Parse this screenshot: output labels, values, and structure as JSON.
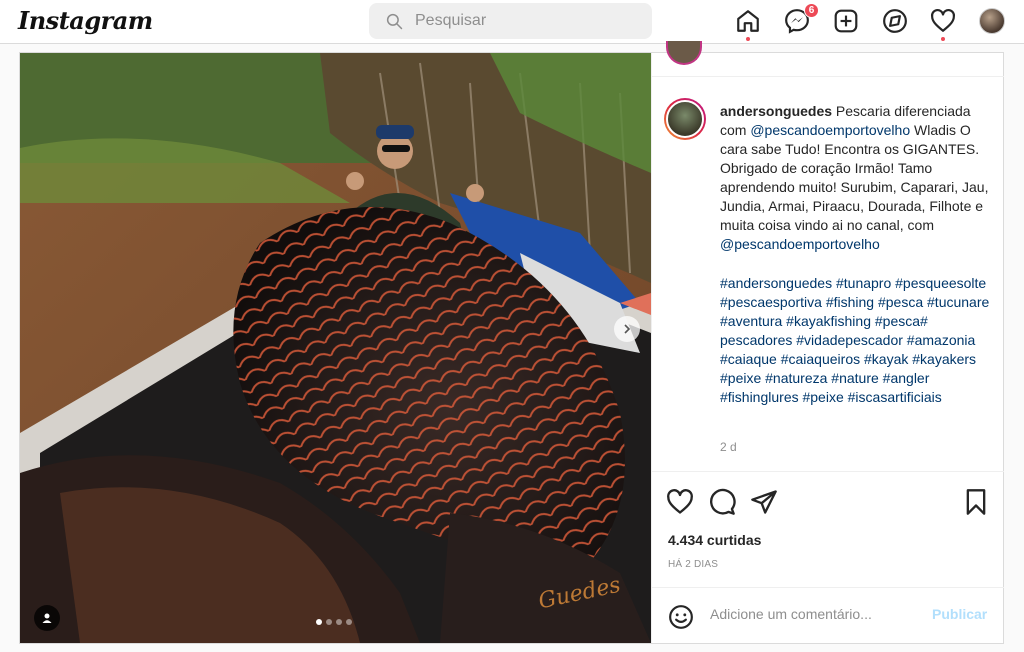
{
  "app": {
    "logo": "Instagram"
  },
  "search": {
    "placeholder": "Pesquisar"
  },
  "nav": {
    "items": [
      {
        "name": "home-icon",
        "active": true
      },
      {
        "name": "messenger-icon",
        "badge": "6"
      },
      {
        "name": "new-post-icon"
      },
      {
        "name": "explore-icon"
      },
      {
        "name": "activity-heart-icon",
        "dot": true
      },
      {
        "name": "profile-avatar"
      }
    ]
  },
  "post": {
    "caption": {
      "username": "andersonguedes",
      "text_1": " Pescaria diferenciada com ",
      "mention_1": "@pescandoemportovelho",
      "text_2": " Wladis O cara sabe Tudo! Encontra os GIGANTES. Obrigado de coração Irmão! Tamo aprendendo muito! Surubim, Caparari, Jau, Jundia, Armai, Piraacu, Dourada, Filhote e muita coisa vindo ai no canal, com ",
      "mention_2": "@pescandoemportovelho",
      "hashtags": "#andersonguedes #tunapro #pesqueesolte #pescaesportiva #fishing #pesca #tucunare #aventura #kayakfishing #pesca# pescadores #vidadepescador  #amazonia #caiaque #caiaqueiros #kayak #kayakers #peixe #natureza #nature #angler #fishinglures #peixe #iscasartificiais",
      "age": "2 d"
    },
    "likes": "4.434 curtidas",
    "date": "HÁ 2 DIAS",
    "comment_placeholder": "Adicione um comentário...",
    "publish_label": "Publicar",
    "signature": "Guedes",
    "carousel": {
      "total": 4,
      "active": 0
    }
  },
  "colors": {
    "accent": "#0095f6",
    "publish_disabled": "#b2dffc",
    "badge": "#ed4956",
    "link": "#00376b"
  }
}
